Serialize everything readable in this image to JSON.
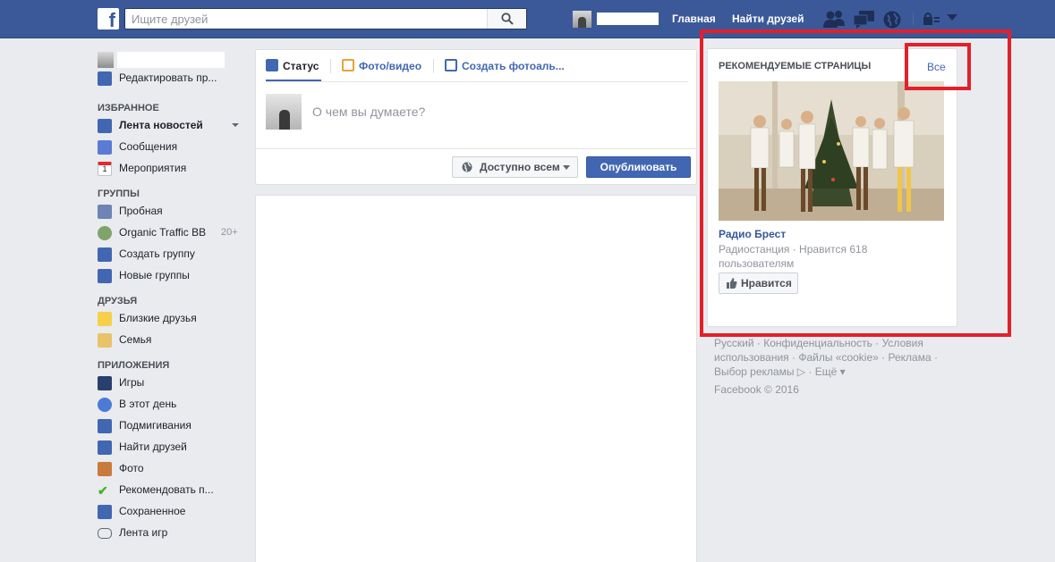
{
  "topbar": {
    "logo": "f",
    "search_placeholder": "Ищите друзей",
    "home_label": "Главная",
    "find_friends_label": "Найти друзей",
    "icons": [
      "friend-requests-icon",
      "messages-icon",
      "notifications-globe-icon",
      "privacy-lock-icon",
      "account-menu-caret-icon"
    ],
    "bar_color": "#3b5998"
  },
  "sidebar": {
    "edit_profile": "Редактировать пр...",
    "sections": [
      {
        "title": "ИЗБРАННОЕ",
        "items": [
          {
            "label": "Лента новостей",
            "icon": "news-feed-icon"
          },
          {
            "label": "Сообщения",
            "icon": "messages-icon"
          },
          {
            "label": "Мероприятия",
            "icon": "events-calendar-icon",
            "icon_text": "1"
          }
        ]
      },
      {
        "title": "ГРУППЫ",
        "items": [
          {
            "label": "Пробная",
            "icon": "group-icon"
          },
          {
            "label": "Organic Traffic BB",
            "icon": "globe-group-icon",
            "count": "20+"
          },
          {
            "label": "Создать группу",
            "icon": "create-group-icon"
          },
          {
            "label": "Новые группы",
            "icon": "new-groups-icon"
          }
        ]
      },
      {
        "title": "ДРУЗЬЯ",
        "items": [
          {
            "label": "Близкие друзья",
            "icon": "star-icon"
          },
          {
            "label": "Семья",
            "icon": "home-icon"
          }
        ]
      },
      {
        "title": "ПРИЛОЖЕНИЯ",
        "items": [
          {
            "label": "Игры",
            "icon": "games-icon"
          },
          {
            "label": "В этот день",
            "icon": "clock-icon"
          },
          {
            "label": "Подмигивания",
            "icon": "poke-icon"
          },
          {
            "label": "Найти друзей",
            "icon": "find-friends-icon"
          },
          {
            "label": "Фото",
            "icon": "photos-icon"
          },
          {
            "label": "Рекомендовать п...",
            "icon": "checkmark-icon"
          },
          {
            "label": "Сохраненное",
            "icon": "bookmark-icon"
          },
          {
            "label": "Лента игр",
            "icon": "gamepad-icon"
          }
        ]
      }
    ]
  },
  "composer": {
    "tab_status": "Статус",
    "tab_photo": "Фото/видео",
    "tab_album": "Создать фотоаль...",
    "placeholder": "О чем вы думаете?",
    "privacy": "Доступно всем",
    "publish": "Опубликовать"
  },
  "recommended": {
    "title": "РЕКОМЕНДУЕМЫЕ СТРАНИЦЫ",
    "see_all": "Все",
    "page_name": "Радио Брест",
    "page_meta": "Радиостанция · Нравится 618 пользователям",
    "like_button": "Нравится"
  },
  "footer": {
    "links": [
      "Русский",
      "Конфиденциальность",
      "Условия использования",
      "Файлы «cookie»",
      "Реклама",
      "Выбор рекламы",
      "Ещё"
    ],
    "copyright": "Facebook © 2016"
  },
  "colors": {
    "brand": "#3b5998",
    "link": "#4267b2",
    "highlight": "#e2202b"
  }
}
